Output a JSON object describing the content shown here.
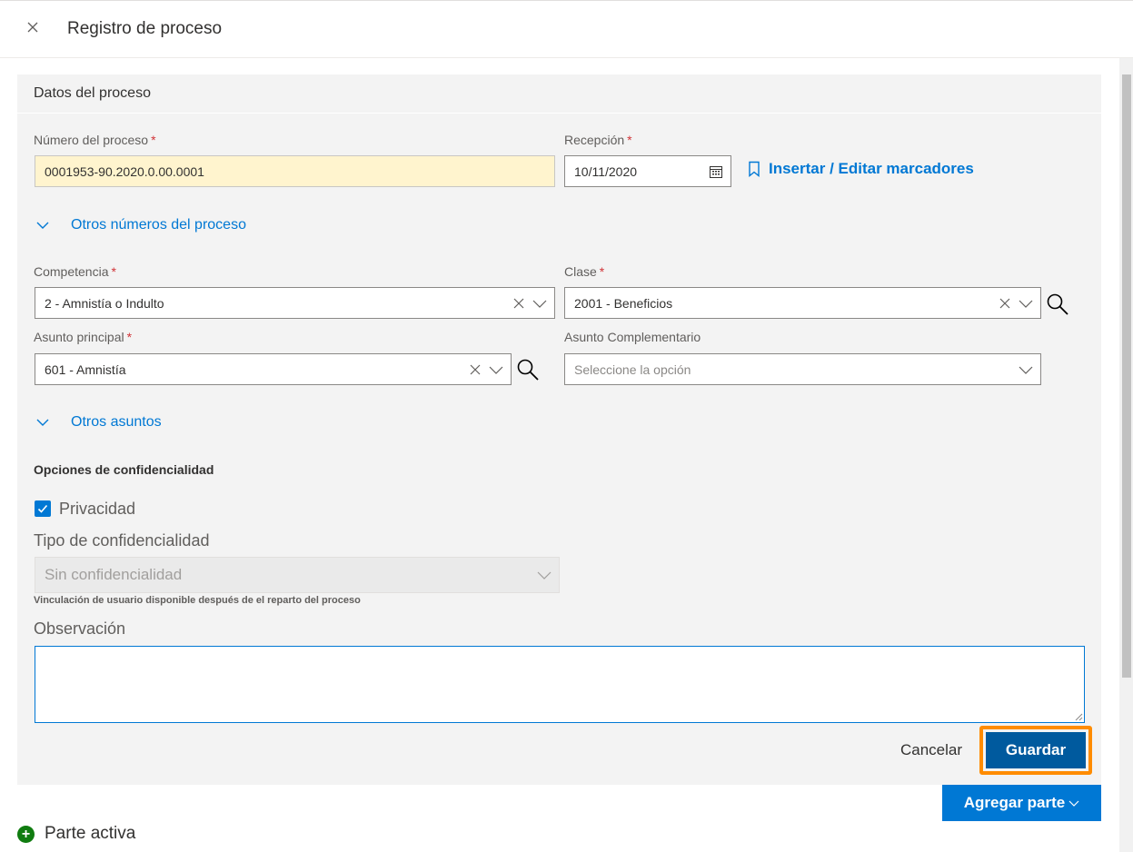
{
  "dialog": {
    "title": "Registro de proceso"
  },
  "panel": {
    "title": "Datos del proceso"
  },
  "numero_proceso": {
    "label": "Número del proceso",
    "required": "*",
    "value": "0001953-90.2020.0.00.0001"
  },
  "recepcion": {
    "label": "Recepción",
    "required": "*",
    "value": "10/11/2020"
  },
  "marcadores_link": "Insertar / Editar marcadores",
  "otros_numeros_link": "Otros números del proceso",
  "competencia": {
    "label": "Competencia",
    "required": "*",
    "value": "2 - Amnistía o Indulto"
  },
  "clase": {
    "label": "Clase",
    "required": "*",
    "value": "2001 - Beneficios"
  },
  "asunto_principal": {
    "label": "Asunto principal",
    "required": "*",
    "value": "601 - Amnistía"
  },
  "asunto_complementario": {
    "label": "Asunto Complementario",
    "placeholder": "Seleccione la opción"
  },
  "otros_asuntos_link": "Otros asuntos",
  "confidencialidad": {
    "section_title": "Opciones de confidencialidad",
    "privacidad_label": "Privacidad",
    "privacidad_checked": true,
    "tipo_label": "Tipo de confidencialidad",
    "tipo_value": "Sin confidencialidad",
    "note": "Vinculación de usuario disponible después de el reparto del proceso"
  },
  "observacion": {
    "label": "Observación",
    "value": ""
  },
  "actions": {
    "cancel": "Cancelar",
    "save": "Guardar",
    "add_party": "Agregar parte"
  },
  "parte_activa": "Parte activa",
  "colors": {
    "accent": "#0078d4",
    "highlight": "#ff8c00",
    "input_highlight": "#fff4ce",
    "required": "#d13438"
  }
}
